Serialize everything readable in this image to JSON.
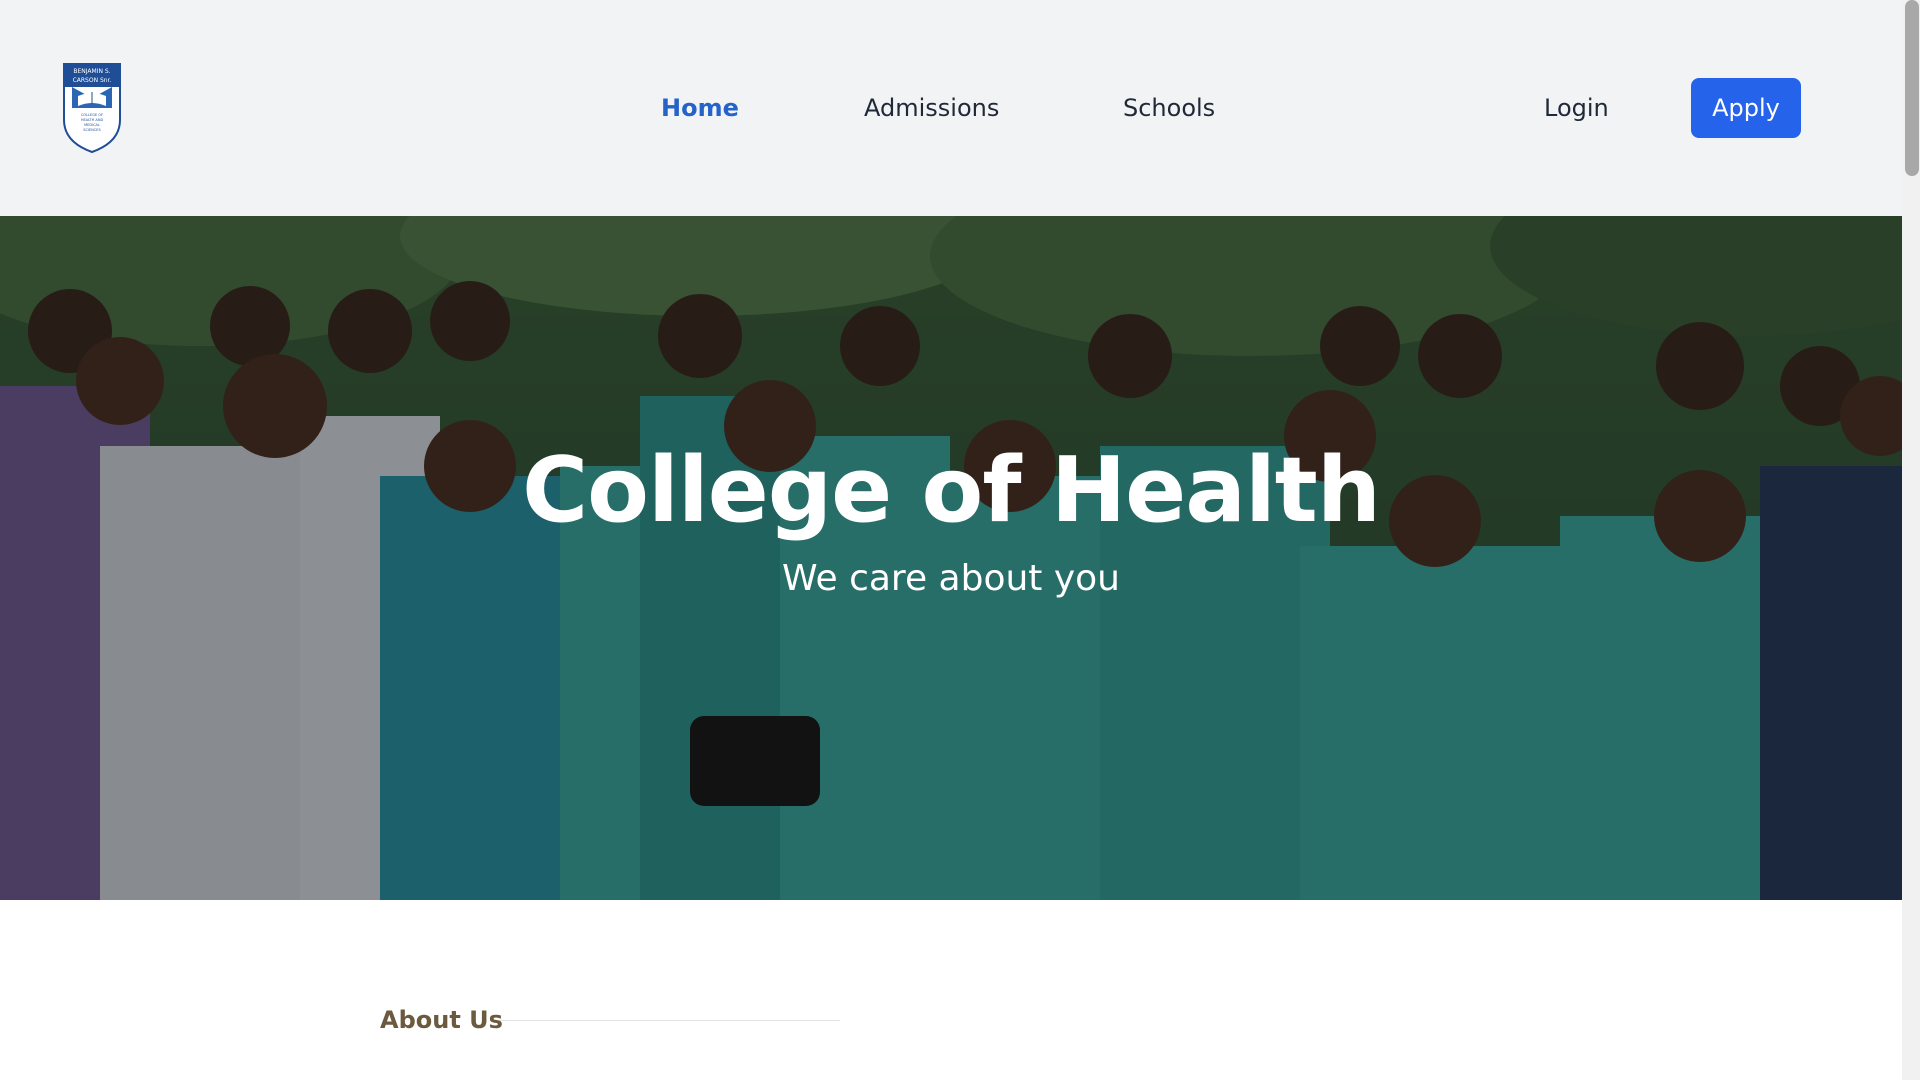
{
  "header": {
    "logo": {
      "icon": "college-crest-logo",
      "line1": "BENJAMIN S.",
      "line2": "CARSON Snr.",
      "line3": "COLLEGE OF",
      "line4": "HEALTH AND",
      "line5": "MEDICAL",
      "line6": "SCIENCES"
    },
    "nav": {
      "home": "Home",
      "admissions": "Admissions",
      "schools": "Schools"
    },
    "login": "Login",
    "apply": "Apply"
  },
  "hero": {
    "title": "College of Health",
    "subtitle": "We care about you"
  },
  "about": {
    "label": "About Us"
  },
  "colors": {
    "accent": "#2563eb",
    "active_nav": "#2563c9",
    "header_bg": "#f2f3f5",
    "scrub_teal": "#3aa39a"
  }
}
